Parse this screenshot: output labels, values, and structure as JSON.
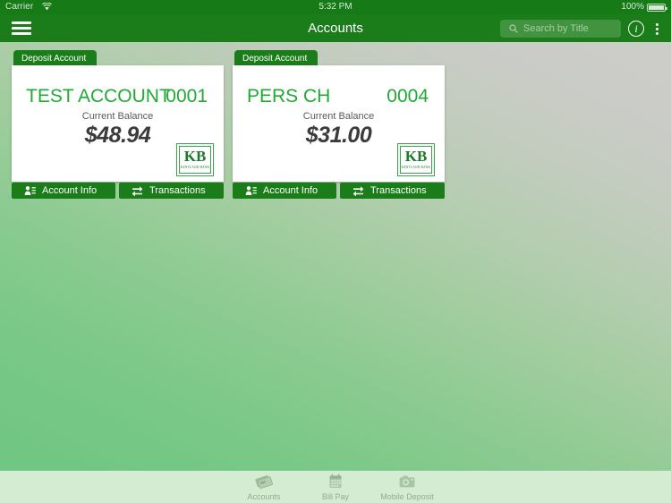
{
  "status_bar": {
    "carrier": "Carrier",
    "wifi_icon": "wifi-icon",
    "time": "5:32 PM",
    "battery_percent": "100%",
    "battery_icon": "battery-full-icon"
  },
  "nav_bar": {
    "menu_icon": "hamburger-menu-icon",
    "title": "Accounts",
    "search": {
      "placeholder": "Search by Title",
      "value": "",
      "icon": "search-icon"
    },
    "info_label": "i",
    "info_icon": "info-circle-icon",
    "overflow_icon": "overflow-menu-icon"
  },
  "accounts": [
    {
      "tab_label": "Deposit Account",
      "name": "TEST ACCOUNT",
      "number": "0001",
      "balance_label": "Current Balance",
      "balance": "$48.94",
      "logo_mark": "KB",
      "logo_name": "KENTLAND BANK",
      "actions": [
        {
          "label": "Account Info",
          "icon": "account-info-icon"
        },
        {
          "label": "Transactions",
          "icon": "transactions-arrows-icon"
        }
      ]
    },
    {
      "tab_label": "Deposit Account",
      "name": "PERS  CH",
      "number": "0004",
      "balance_label": "Current Balance",
      "balance": "$31.00",
      "logo_mark": "KB",
      "logo_name": "KENTLAND BANK",
      "actions": [
        {
          "label": "Account Info",
          "icon": "account-info-icon"
        },
        {
          "label": "Transactions",
          "icon": "transactions-arrows-icon"
        }
      ]
    }
  ],
  "tab_bar": {
    "items": [
      {
        "label": "Accounts",
        "icon": "cards-stack-icon"
      },
      {
        "label": "Bill Pay",
        "icon": "calendar-icon"
      },
      {
        "label": "Mobile Deposit",
        "icon": "camera-icon"
      }
    ]
  },
  "colors": {
    "brand_green": "#1b7d1a",
    "status_green": "#167a17",
    "account_text_green": "#1faa34",
    "tab_bar_bg": "#d4ecd2",
    "card_bg": "#ffffff"
  }
}
